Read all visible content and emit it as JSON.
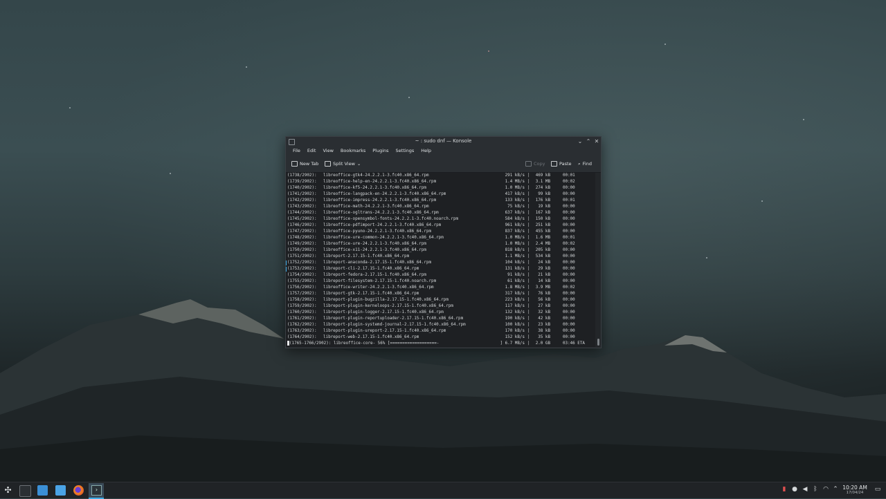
{
  "window": {
    "title": "~ : sudo dnf — Konsole",
    "menu": [
      "File",
      "Edit",
      "View",
      "Bookmarks",
      "Plugins",
      "Settings",
      "Help"
    ],
    "toolbar": {
      "new_tab": "New Tab",
      "split_view": "Split View",
      "copy": "Copy",
      "paste": "Paste",
      "find": "Find"
    }
  },
  "terminal": {
    "lines": [
      {
        "idx": "(1738/2902):",
        "name": "libreoffice-gtk4-24.2.2.1-3.fc40.x86_64.rpm",
        "rate": "291 kB/s",
        "size": "469 kB",
        "time": "00:01"
      },
      {
        "idx": "(1739/2902):",
        "name": "libreoffice-help-en-24.2.2.1-3.fc40.x86_64.rpm",
        "rate": "1.4 MB/s",
        "size": "3.1 MB",
        "time": "00:02"
      },
      {
        "idx": "(1740/2902):",
        "name": "libreoffice-kf5-24.2.2.1-3.fc40.x86_64.rpm",
        "rate": "1.0 MB/s",
        "size": "274 kB",
        "time": "00:00"
      },
      {
        "idx": "(1741/2902):",
        "name": "libreoffice-langpack-en-24.2.2.1-3.fc40.x86_64.rpm",
        "rate": "417 kB/s",
        "size": "99 kB",
        "time": "00:00"
      },
      {
        "idx": "(1742/2902):",
        "name": "libreoffice-impress-24.2.2.1-3.fc40.x86_64.rpm",
        "rate": "133 kB/s",
        "size": "176 kB",
        "time": "00:01"
      },
      {
        "idx": "(1743/2902):",
        "name": "libreoffice-math-24.2.2.1-3.fc40.x86_64.rpm",
        "rate": "75 kB/s",
        "size": "19 kB",
        "time": "00:00"
      },
      {
        "idx": "(1744/2902):",
        "name": "libreoffice-ogltrans-24.2.2.1-3.fc40.x86_64.rpm",
        "rate": "637 kB/s",
        "size": "167 kB",
        "time": "00:00"
      },
      {
        "idx": "(1745/2902):",
        "name": "libreoffice-opensymbol-fonts-24.2.2.1-3.fc40.noarch.rpm",
        "rate": "584 kB/s",
        "size": "150 kB",
        "time": "00:00"
      },
      {
        "idx": "(1746/2902):",
        "name": "libreoffice-pdfimport-24.2.2.1-3.fc40.x86_64.rpm",
        "rate": "961 kB/s",
        "size": "251 kB",
        "time": "00:00"
      },
      {
        "idx": "(1747/2902):",
        "name": "libreoffice-pyuno-24.2.2.1-3.fc40.x86_64.rpm",
        "rate": "837 kB/s",
        "size": "455 kB",
        "time": "00:00"
      },
      {
        "idx": "(1748/2902):",
        "name": "libreoffice-ure-common-24.2.2.1-3.fc40.x86_64.rpm",
        "rate": "1.0 MB/s",
        "size": "1.6 MB",
        "time": "00:01"
      },
      {
        "idx": "(1749/2902):",
        "name": "libreoffice-ure-24.2.2.1-3.fc40.x86_64.rpm",
        "rate": "1.0 MB/s",
        "size": "2.4 MB",
        "time": "00:02"
      },
      {
        "idx": "(1750/2902):",
        "name": "libreoffice-x11-24.2.2.1-3.fc40.x86_64.rpm",
        "rate": "818 kB/s",
        "size": "205 kB",
        "time": "00:00"
      },
      {
        "idx": "(1751/2902):",
        "name": "libreport-2.17.15-1.fc40.x86_64.rpm",
        "rate": "1.1 MB/s",
        "size": "534 kB",
        "time": "00:00"
      },
      {
        "idx": "(1752/2902):",
        "name": "libreport-anaconda-2.17.15-1.fc40.x86_64.rpm",
        "rate": "104 kB/s",
        "size": "24 kB",
        "time": "00:00"
      },
      {
        "idx": "(1753/2902):",
        "name": "libreport-cli-2.17.15-1.fc40.x86_64.rpm",
        "rate": "131 kB/s",
        "size": "29 kB",
        "time": "00:00"
      },
      {
        "idx": "(1754/2902):",
        "name": "libreport-fedora-2.17.15-1.fc40.x86_64.rpm",
        "rate": "91 kB/s",
        "size": "21 kB",
        "time": "00:00"
      },
      {
        "idx": "(1755/2902):",
        "name": "libreport-filesystem-2.17.15-1.fc40.noarch.rpm",
        "rate": "61 kB/s",
        "size": "14 kB",
        "time": "00:00"
      },
      {
        "idx": "(1756/2902):",
        "name": "libreoffice-writer-24.2.2.1-3.fc40.x86_64.rpm",
        "rate": "1.8 MB/s",
        "size": "3.9 MB",
        "time": "00:02"
      },
      {
        "idx": "(1757/2902):",
        "name": "libreport-gtk-2.17.15-1.fc40.x86_64.rpm",
        "rate": "317 kB/s",
        "size": "76 kB",
        "time": "00:00"
      },
      {
        "idx": "(1758/2902):",
        "name": "libreport-plugin-bugzilla-2.17.15-1.fc40.x86_64.rpm",
        "rate": "223 kB/s",
        "size": "56 kB",
        "time": "00:00"
      },
      {
        "idx": "(1759/2902):",
        "name": "libreport-plugin-kerneloops-2.17.15-1.fc40.x86_64.rpm",
        "rate": "117 kB/s",
        "size": "27 kB",
        "time": "00:00"
      },
      {
        "idx": "(1760/2902):",
        "name": "libreport-plugin-logger-2.17.15-1.fc40.x86_64.rpm",
        "rate": "132 kB/s",
        "size": "32 kB",
        "time": "00:00"
      },
      {
        "idx": "(1761/2902):",
        "name": "libreport-plugin-reportuploader-2.17.15-1.fc40.x86_64.rpm",
        "rate": "190 kB/s",
        "size": "42 kB",
        "time": "00:00"
      },
      {
        "idx": "(1762/2902):",
        "name": "libreport-plugin-systemd-journal-2.17.15-1.fc40.x86_64.rpm",
        "rate": "100 kB/s",
        "size": "23 kB",
        "time": "00:00"
      },
      {
        "idx": "(1763/2902):",
        "name": "libreport-plugin-ureport-2.17.15-1.fc40.x86_64.rpm",
        "rate": "170 kB/s",
        "size": "38 kB",
        "time": "00:00"
      },
      {
        "idx": "(1764/2902):",
        "name": "libreport-web-2.17.15-1.fc40.x86_64.rpm",
        "rate": "152 kB/s",
        "size": "35 kB",
        "time": "00:00"
      }
    ],
    "progress": {
      "text": "(1765-1766/2902): libreoffice-core- 56% [===================-",
      "rate": "] 6.7 MB/s",
      "size": "2.0 GB",
      "eta": "03:46 ETA"
    }
  },
  "taskbar": {
    "clock_time": "10:20 AM",
    "clock_date": "17/04/24"
  },
  "colors": {
    "accent": "#3daee9",
    "terminal_bg": "#1e2023",
    "panel_bg": "#202326"
  }
}
